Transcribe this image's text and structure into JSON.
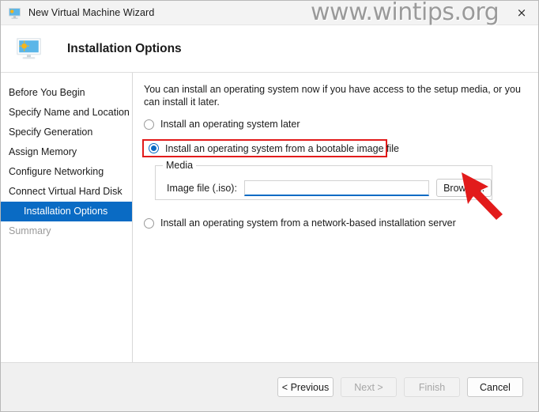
{
  "window": {
    "title": "New Virtual Machine Wizard",
    "icon": "virtual-machine-monitor-icon",
    "close_label": "×"
  },
  "watermark": {
    "text": "www.wintips.org"
  },
  "header": {
    "title": "Installation Options",
    "icon": "virtual-machine-monitor-icon"
  },
  "sidebar": {
    "items": [
      {
        "label": "Before You Begin",
        "state": "normal"
      },
      {
        "label": "Specify Name and Location",
        "state": "normal"
      },
      {
        "label": "Specify Generation",
        "state": "normal"
      },
      {
        "label": "Assign Memory",
        "state": "normal"
      },
      {
        "label": "Configure Networking",
        "state": "normal"
      },
      {
        "label": "Connect Virtual Hard Disk",
        "state": "normal"
      },
      {
        "label": "Installation Options",
        "state": "current"
      },
      {
        "label": "Summary",
        "state": "disabled"
      }
    ]
  },
  "content": {
    "intro": "You can install an operating system now if you have access to the setup media, or you can install it later.",
    "options": [
      {
        "label": "Install an operating system later",
        "checked": false
      },
      {
        "label": "Install an operating system from a bootable image file",
        "checked": true
      },
      {
        "label": "Install an operating system from a network-based installation server",
        "checked": false
      }
    ],
    "media": {
      "legend": "Media",
      "iso_label": "Image file (.iso):",
      "iso_value": "",
      "iso_placeholder": "",
      "browse_label": "Browse..."
    }
  },
  "annotations": {
    "highlight_color": "#e21b1b",
    "arrow_color": "#e21b1b",
    "accent_color": "#0a6bc4"
  },
  "footer": {
    "buttons": [
      {
        "label": "< Previous",
        "enabled": true
      },
      {
        "label": "Next >",
        "enabled": false
      },
      {
        "label": "Finish",
        "enabled": false
      },
      {
        "label": "Cancel",
        "enabled": true
      }
    ]
  }
}
